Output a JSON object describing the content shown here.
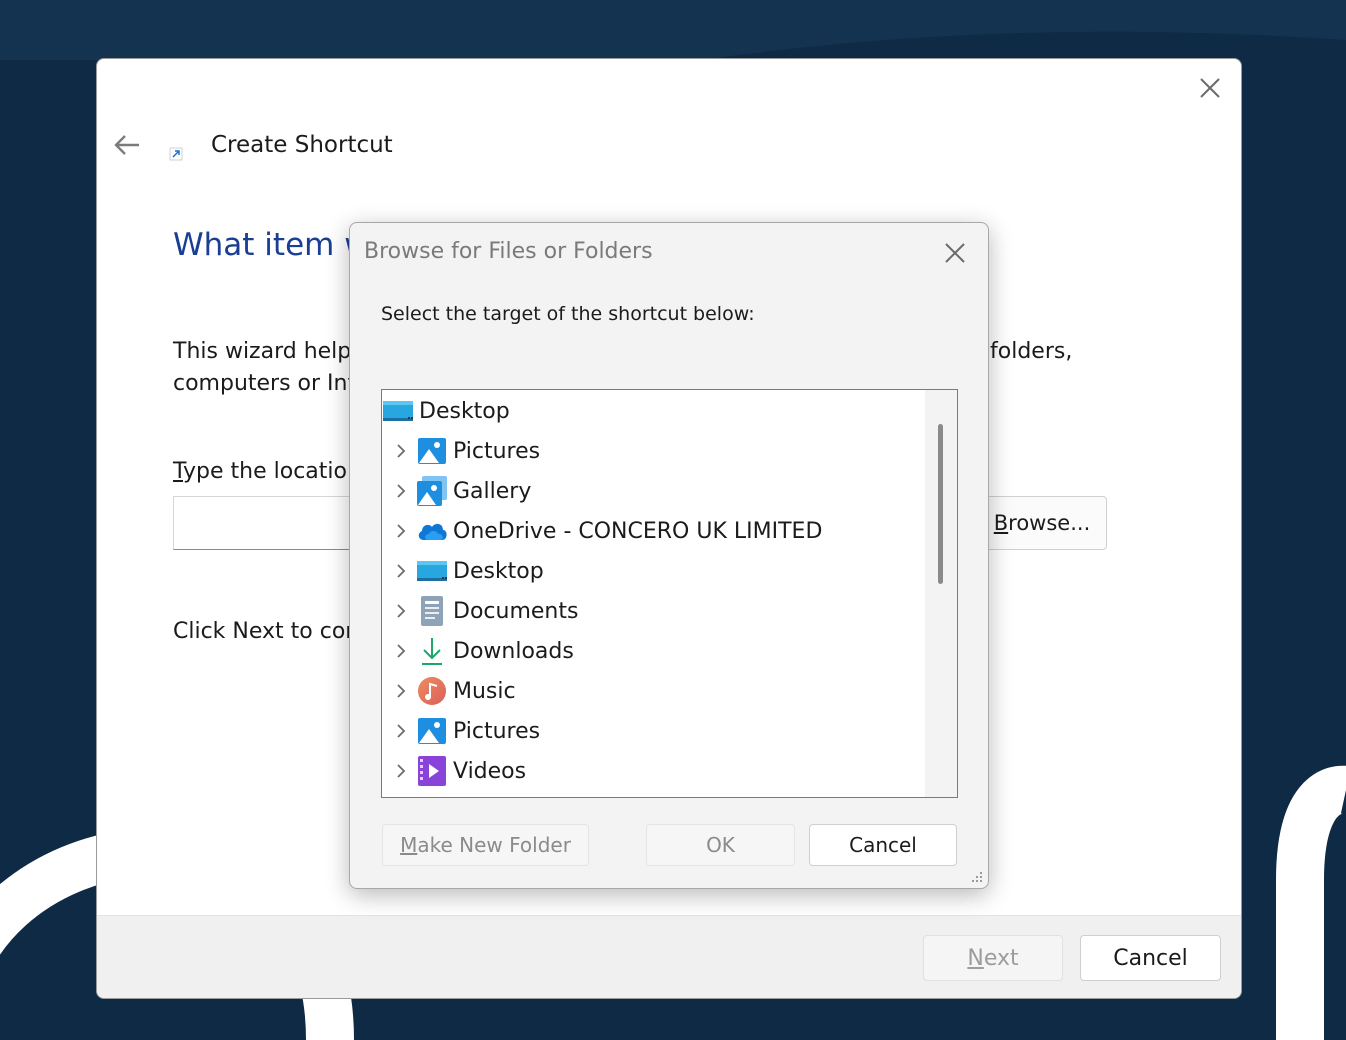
{
  "wizard": {
    "title": "Create Shortcut",
    "heading": "What item w",
    "description_line1_start": "This wizard helps",
    "description_line1_end": "folders,",
    "description_line2": "computers or Int",
    "location_label_accesskey": "T",
    "location_label_rest": "ype the location",
    "location_value": "",
    "browse_button_accesskey": "B",
    "browse_button_rest": "rowse...",
    "next_hint": "Click Next to con",
    "next_button_accesskey": "N",
    "next_button_rest": "ext",
    "cancel_button": "Cancel"
  },
  "browse_dialog": {
    "title": "Browse for Files or Folders",
    "prompt": "Select the target of the shortcut below:",
    "tree": [
      {
        "label": "Desktop",
        "icon": "desktop-folder-icon",
        "expandable": false,
        "level": 0
      },
      {
        "label": "Pictures",
        "icon": "pictures-icon",
        "expandable": true,
        "level": 1
      },
      {
        "label": "Gallery",
        "icon": "gallery-icon",
        "expandable": true,
        "level": 1
      },
      {
        "label": "OneDrive - CONCERO UK LIMITED",
        "icon": "onedrive-cloud-icon",
        "expandable": true,
        "level": 1
      },
      {
        "label": "Desktop",
        "icon": "desktop-folder-icon",
        "expandable": true,
        "level": 1
      },
      {
        "label": "Documents",
        "icon": "documents-icon",
        "expandable": true,
        "level": 1
      },
      {
        "label": "Downloads",
        "icon": "downloads-icon",
        "expandable": true,
        "level": 1
      },
      {
        "label": "Music",
        "icon": "music-icon",
        "expandable": true,
        "level": 1
      },
      {
        "label": "Pictures",
        "icon": "pictures-icon",
        "expandable": true,
        "level": 1
      },
      {
        "label": "Videos",
        "icon": "videos-icon",
        "expandable": true,
        "level": 1
      }
    ],
    "make_new_folder_accesskey": "M",
    "make_new_folder_rest": "ake New Folder",
    "ok_button": "OK",
    "cancel_button": "Cancel"
  },
  "colors": {
    "background": "#0e2a45",
    "heading_blue": "#1a3e93"
  }
}
